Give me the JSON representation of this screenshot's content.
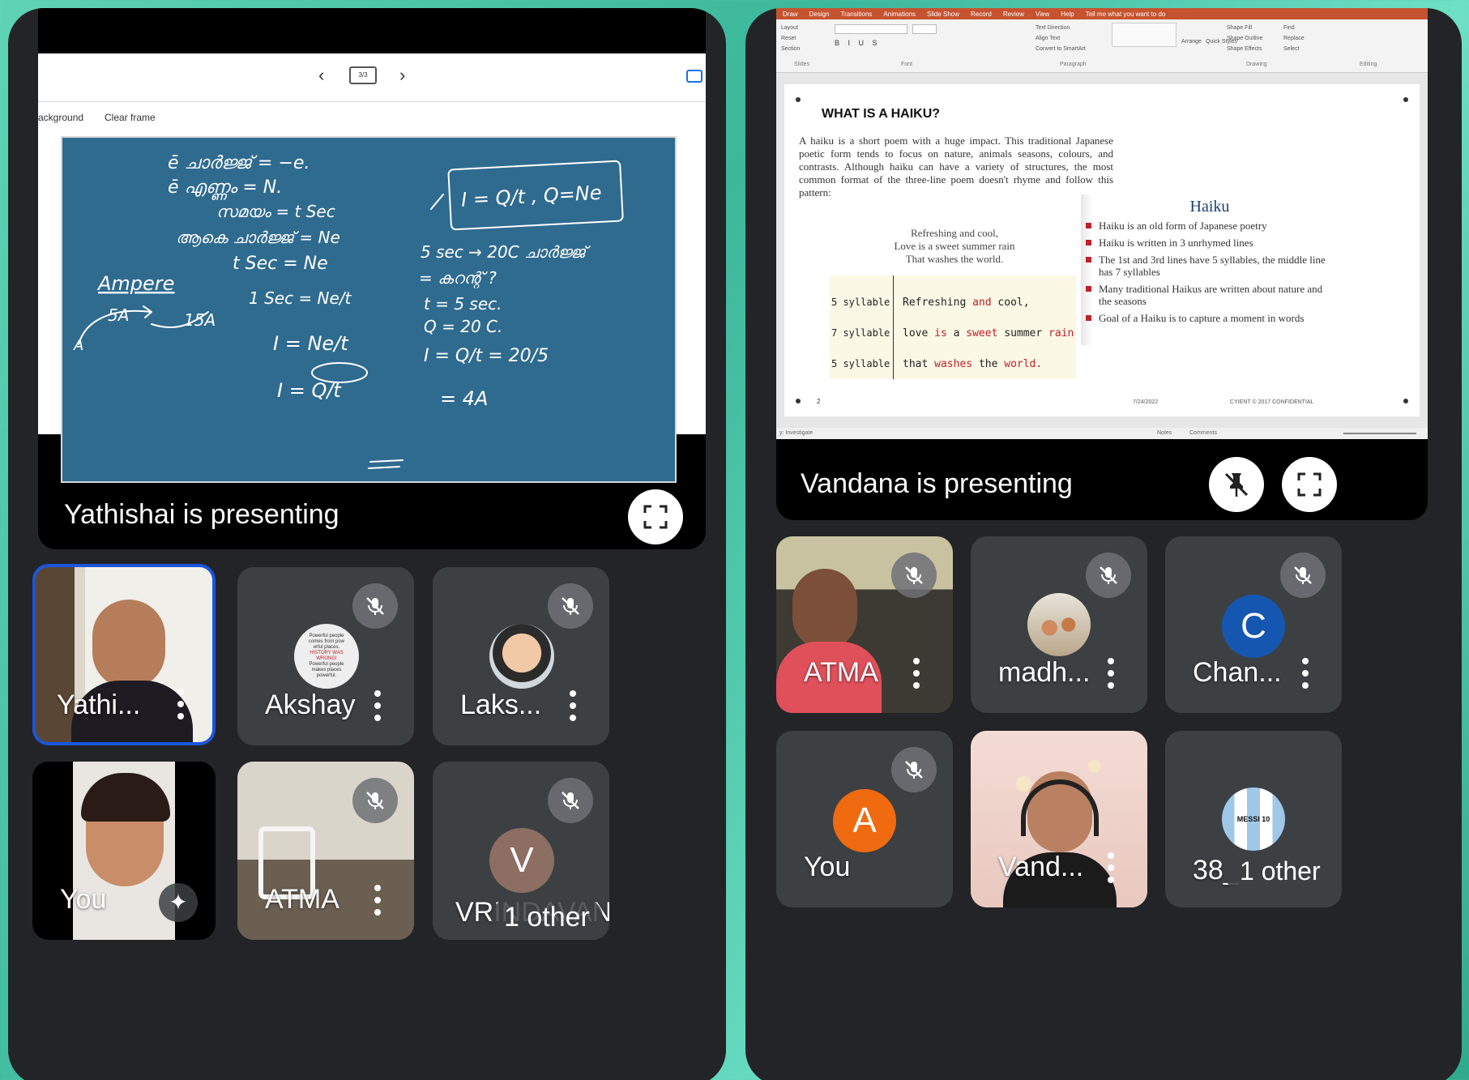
{
  "left": {
    "presenter_label": "Yathishai is presenting",
    "toolbar": {
      "frame_counter": "3/3",
      "background_label": "ackground",
      "clear_frame_label": "Clear frame"
    },
    "board": {
      "lines_left": [
        "ē  ചാർജ്ജ്  = −e.",
        "ē  എണ്ണം    = N.",
        "സമയം     = t   Sec",
        "ആകെ ചാർജ്ജ്  =   Ne",
        "t   Sec  =  Ne"
      ],
      "ampere_label": "Ampere",
      "middle_lines": [
        "1  Sec  =  Ne/t",
        "I  =  Ne/t",
        "I =  Q/t"
      ],
      "formula_box": "I = Q/t ,  Q=Ne",
      "right_lines": [
        "5 sec → 20C ചാർജ്ജ്",
        "= കറന്റ് ?",
        "t = 5 sec.",
        "Q = 20 C.",
        "I = Q/t  =  20/5",
        "=  4A"
      ],
      "amp_sketch": [
        "5A",
        "15A",
        "A"
      ]
    },
    "tiles": [
      {
        "name": "Yathi...",
        "muted": false,
        "active": true
      },
      {
        "name": "Akshay",
        "muted": true,
        "avatar_text": [
          "Powerful people",
          "comes from pow",
          "erful places.",
          "HISTORY WAS",
          "WRONG!",
          "Powerful people",
          "makes places",
          "powerful."
        ]
      },
      {
        "name": "Laks...",
        "muted": true
      },
      {
        "name": "You",
        "muted": false
      },
      {
        "name": "ATMA",
        "muted": true
      },
      {
        "name": "VRINDAVAN...",
        "muted": true,
        "avatar_letter": "V",
        "overlay": "1 other"
      }
    ]
  },
  "right": {
    "presenter_label": "Vandana is presenting",
    "ribbon_tabs": [
      "Draw",
      "Design",
      "Transitions",
      "Animations",
      "Slide Show",
      "Record",
      "Review",
      "View",
      "Help",
      "Tell me what you want to do"
    ],
    "ribbon_groups": [
      "Slides",
      "Font",
      "Paragraph",
      "Drawing",
      "Editing"
    ],
    "ribbon_items": [
      "Layout",
      "Reset",
      "Section",
      "Text Direction",
      "Align Text",
      "Convert to SmartArt",
      "Arrange",
      "Quick Styles",
      "Shape Fill",
      "Shape Outline",
      "Shape Effects",
      "Find",
      "Replace",
      "Select"
    ],
    "slide": {
      "title": "WHAT IS A HAIKU?",
      "intro": "A haiku is a short poem with a huge impact. This traditional Japanese poetic form tends to focus on nature, animals seasons, colours, and contrasts. Although haiku can have a variety of structures, the most common format of the three-line poem doesn't rhyme and follow this pattern:",
      "poem": [
        "Refreshing and cool,",
        "Love is a sweet summer rain",
        "That washes the world."
      ],
      "syllables": [
        {
          "label": "5 syllable",
          "line": [
            "Refreshing",
            " and ",
            "cool,"
          ]
        },
        {
          "label": "7 syllable",
          "line": [
            "love",
            " is ",
            "a",
            " sweet ",
            "summer",
            " rain",
            ""
          ]
        },
        {
          "label": "5 syllable",
          "line": [
            "that",
            " washes ",
            "the",
            " world.",
            ""
          ]
        }
      ],
      "panel_title": "Haiku",
      "bullets": [
        "Haiku is an old form of Japanese poetry",
        "Haiku is written in 3 unrhymed lines",
        "The 1st and 3rd lines have 5 syllables, the middle line has 7 syllables",
        "Many traditional Haikus are written about nature and the seasons",
        "Goal of a Haiku is to capture a moment in words"
      ],
      "page_number": "2",
      "date": "7/24/2022",
      "footer": "CYIENT © 2017 CONFIDENTIAL"
    },
    "status": {
      "left": "y: Investigate",
      "notes": "Notes",
      "comments": "Comments"
    },
    "tiles": [
      {
        "name": "ATMA",
        "muted": true
      },
      {
        "name": "madh...",
        "muted": true
      },
      {
        "name": "Chan...",
        "muted": true,
        "avatar_letter": "C"
      },
      {
        "name": "You",
        "muted": true,
        "avatar_letter": "A"
      },
      {
        "name": "Vand...",
        "muted": false
      },
      {
        "name": "38_",
        "muted": false,
        "overlay": "1 other",
        "jersey": "MESSI 10"
      }
    ]
  },
  "colors": {
    "tile_bg": "#3c4043",
    "phone_bg": "#232427",
    "board_blue": "#2f6b8f",
    "active_border": "#1a56db",
    "avatar_v": "#8d6e63",
    "avatar_c": "#1557b0",
    "avatar_a": "#f06a0f",
    "ppt_accent": "#c5532f",
    "bullet_red": "#c0202a"
  }
}
